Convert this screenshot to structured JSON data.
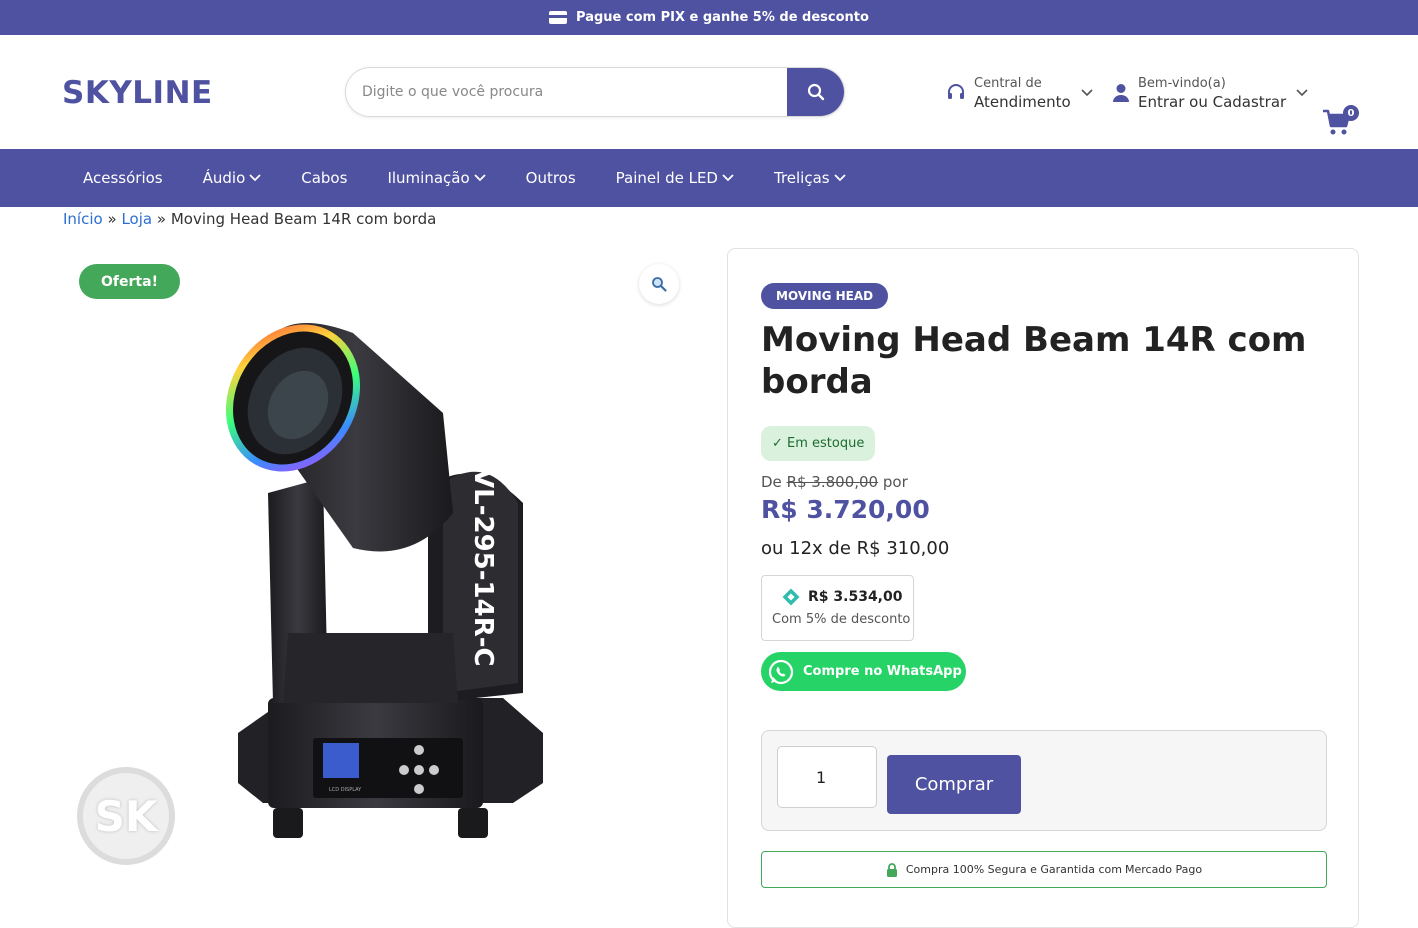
{
  "topbar": {
    "text": "Pague com PIX e ganhe 5% de desconto"
  },
  "header": {
    "logo": "SKYLINE",
    "search_placeholder": "Digite o que você procura",
    "support_small": "Central de",
    "support_big": "Atendimento",
    "account_small": "Bem-vindo(a)",
    "account_big": "Entrar ou Cadastrar",
    "cart_count": "0"
  },
  "nav": {
    "items": [
      {
        "label": "Acessórios"
      },
      {
        "label": "Áudio"
      },
      {
        "label": "Cabos"
      },
      {
        "label": "Iluminação"
      },
      {
        "label": "Outros"
      },
      {
        "label": "Painel de LED"
      },
      {
        "label": "Treliças"
      }
    ]
  },
  "breadcrumb": {
    "home": "Início",
    "sep": "»",
    "shop": "Loja",
    "current": "Moving Head Beam 14R com borda"
  },
  "gallery": {
    "sale_badge": "Oferta!",
    "device_label": "VL-295-14R-C",
    "display_label": "LCD DISPLAY",
    "watermark": "SK"
  },
  "product": {
    "category": "MOVING HEAD",
    "title": "Moving Head Beam 14R com borda",
    "stock": "✓ Em estoque",
    "old_prefix": "De",
    "old_price": "R$ 3.800,00",
    "old_suffix": "por",
    "price": "R$ 3.720,00",
    "installment": "ou 12x de R$ 310,00",
    "pix_price": "R$ 3.534,00",
    "pix_sub": "Com 5% de desconto",
    "whatsapp": "Compre no WhatsApp",
    "quantity": "1",
    "buy": "Comprar",
    "secure_prefix": "Compra 100% Segura e Garantida com ",
    "secure_brand": "Mercado Pago"
  },
  "colors": {
    "brand": "#4e52a0",
    "sale": "#43a85a",
    "whatsapp": "#26d366",
    "link": "#2a6fd1"
  }
}
